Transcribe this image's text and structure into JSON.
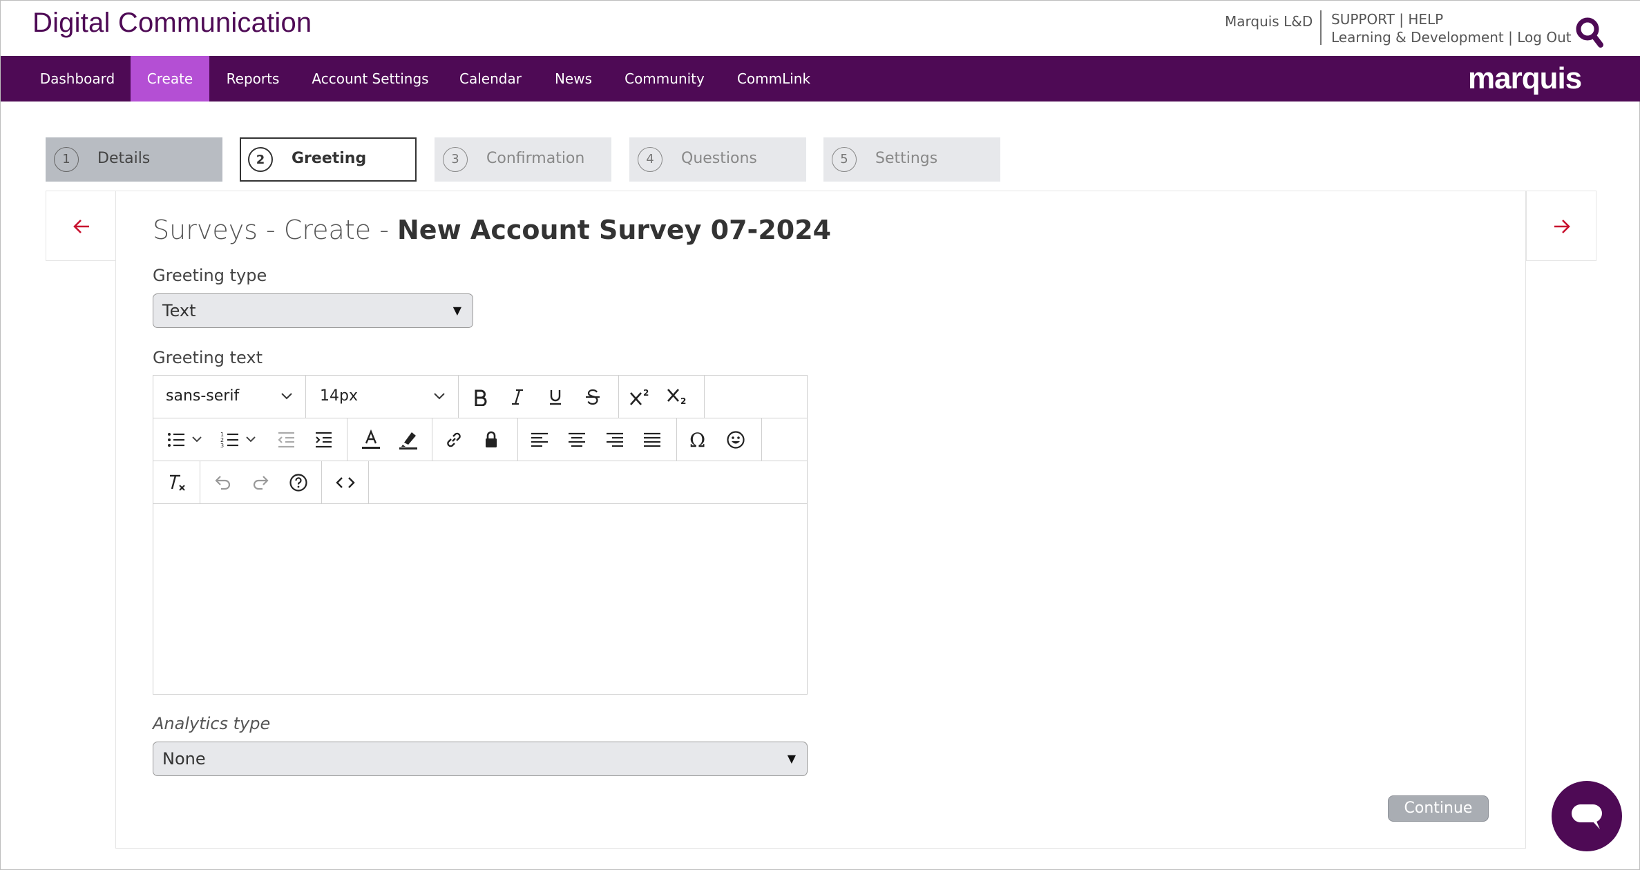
{
  "header": {
    "brand": "Digital Communication",
    "account_name": "Marquis L&D",
    "support": "SUPPORT",
    "help": "HELP",
    "learning": "Learning & Development",
    "logout": "Log Out",
    "separator": "|"
  },
  "nav": {
    "items": [
      "Dashboard",
      "Create",
      "Reports",
      "Account Settings",
      "Calendar",
      "News",
      "Community",
      "CommLink"
    ],
    "active": "Create",
    "logo": "marquis"
  },
  "steps": [
    {
      "num": "1",
      "label": "Details",
      "state": "done"
    },
    {
      "num": "2",
      "label": "Greeting",
      "state": "current"
    },
    {
      "num": "3",
      "label": "Confirmation",
      "state": "upcoming"
    },
    {
      "num": "4",
      "label": "Questions",
      "state": "upcoming"
    },
    {
      "num": "5",
      "label": "Settings",
      "state": "upcoming"
    }
  ],
  "page": {
    "title_prefix": "Surveys - Create - ",
    "title_name": "New Account Survey 07-2024"
  },
  "form": {
    "greeting_type_label": "Greeting type",
    "greeting_type_value": "Text",
    "greeting_text_label": "Greeting text",
    "analytics_type_label": "Analytics type",
    "analytics_type_value": "None",
    "continue_label": "Continue"
  },
  "editor": {
    "font_family": "sans-serif",
    "font_size": "14px",
    "content": ""
  },
  "colors": {
    "brand_purple": "#4e0a55",
    "nav_active": "#b44fd4",
    "arrow_red": "#c8102e",
    "step_done": "#b8bcc2",
    "step_upcoming": "#e7e8eb"
  }
}
